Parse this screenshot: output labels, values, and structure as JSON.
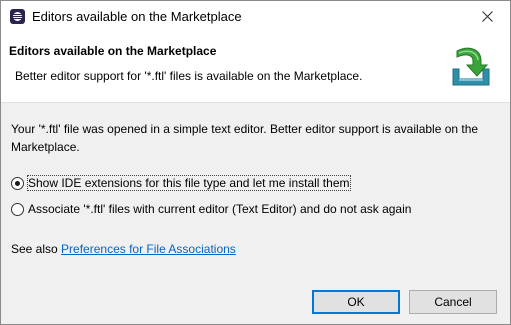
{
  "window": {
    "title": "Editors available on the Marketplace",
    "app_icon": "eclipse-icon",
    "close_icon": "close-icon"
  },
  "banner": {
    "title": "Editors available on the Marketplace",
    "description": "Better editor support for '*.ftl' files is available on the Marketplace.",
    "icon": "marketplace-download-icon"
  },
  "body": {
    "message": "Your '*.ftl' file was opened in a simple text editor. Better editor support is available on the Marketplace.",
    "options": [
      {
        "label": "Show IDE extensions for this file type and let me install them",
        "selected": true
      },
      {
        "label": "Associate '*.ftl' files with current editor (Text Editor) and do not ask again",
        "selected": false
      }
    ],
    "see_also_prefix": "See also ",
    "see_also_link": "Preferences for File Associations"
  },
  "buttons": {
    "ok": "OK",
    "cancel": "Cancel"
  },
  "colors": {
    "link": "#0066cc",
    "accent": "#0078d7",
    "icon_green": "#3aa33a",
    "icon_tray": "#2f8ea8"
  }
}
